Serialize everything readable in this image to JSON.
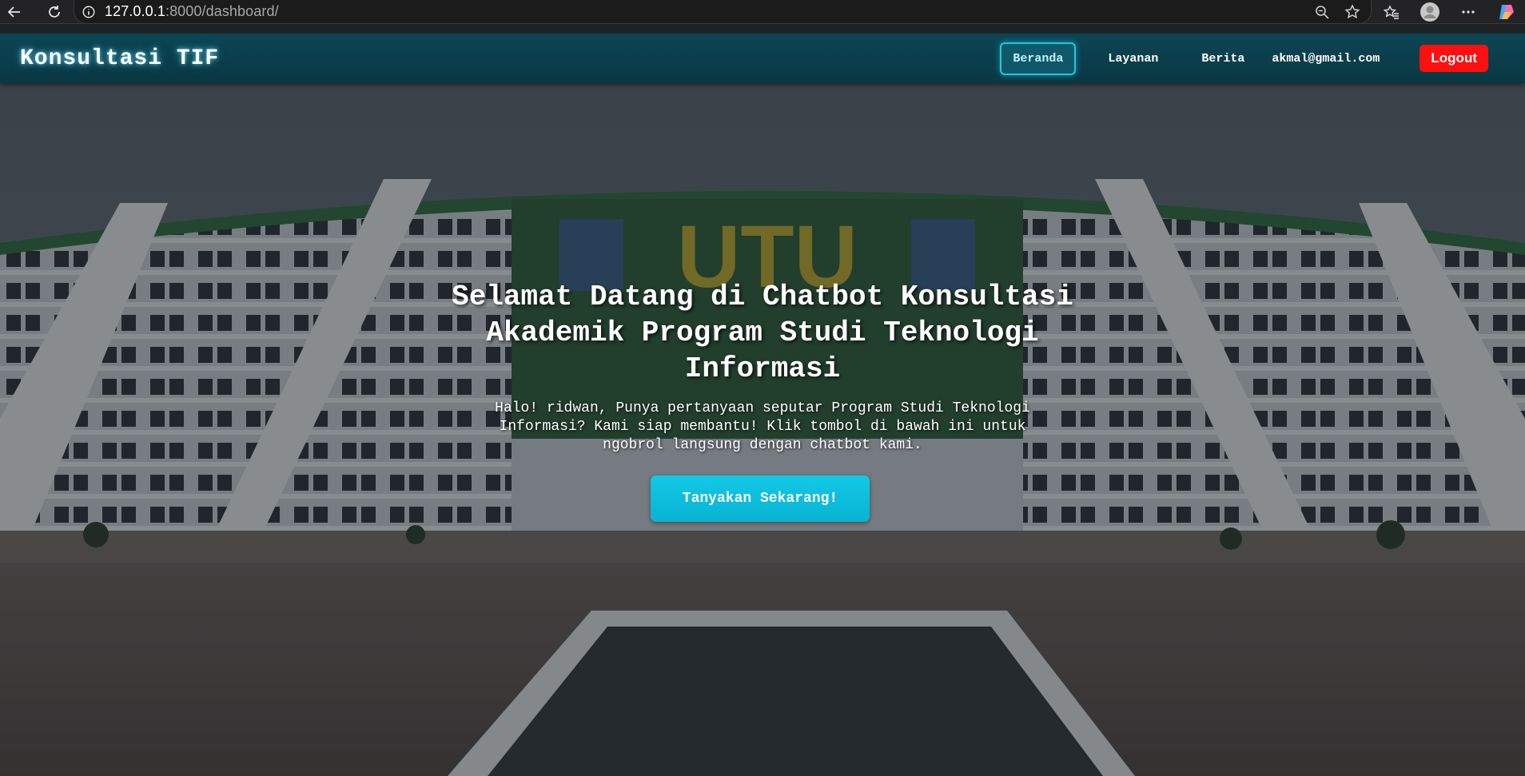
{
  "browser": {
    "url_host": "127.0.0.1",
    "url_path": ":8000/dashboard/",
    "icons": [
      "back-icon",
      "reload-icon",
      "info-icon",
      "zoom-icon",
      "star-icon",
      "favorites-icon",
      "profile-icon",
      "more-icon",
      "copilot-icon"
    ]
  },
  "navbar": {
    "brand": "Konsultasi TIF",
    "links": [
      "Beranda",
      "Layanan",
      "Berita"
    ],
    "active": "Beranda",
    "user_email": "akmal@gmail.com",
    "logout_label": "Logout"
  },
  "hero": {
    "title": "Selamat Datang di Chatbot Konsultasi Akademik Program Studi Teknologi Informasi",
    "subtitle": "Halo! ridwan, Punya pertanyaan seputar Program Studi Teknologi Informasi? Kami siap membantu! Klik tombol di bawah ini untuk ngobrol langsung dengan chatbot kami.",
    "cta_label": "Tanyakan Sekarang!",
    "background": "campus-building-photo"
  },
  "colors": {
    "navbar": "#0a3743",
    "accent": "#13c9e6",
    "logout": "#ff1010"
  }
}
